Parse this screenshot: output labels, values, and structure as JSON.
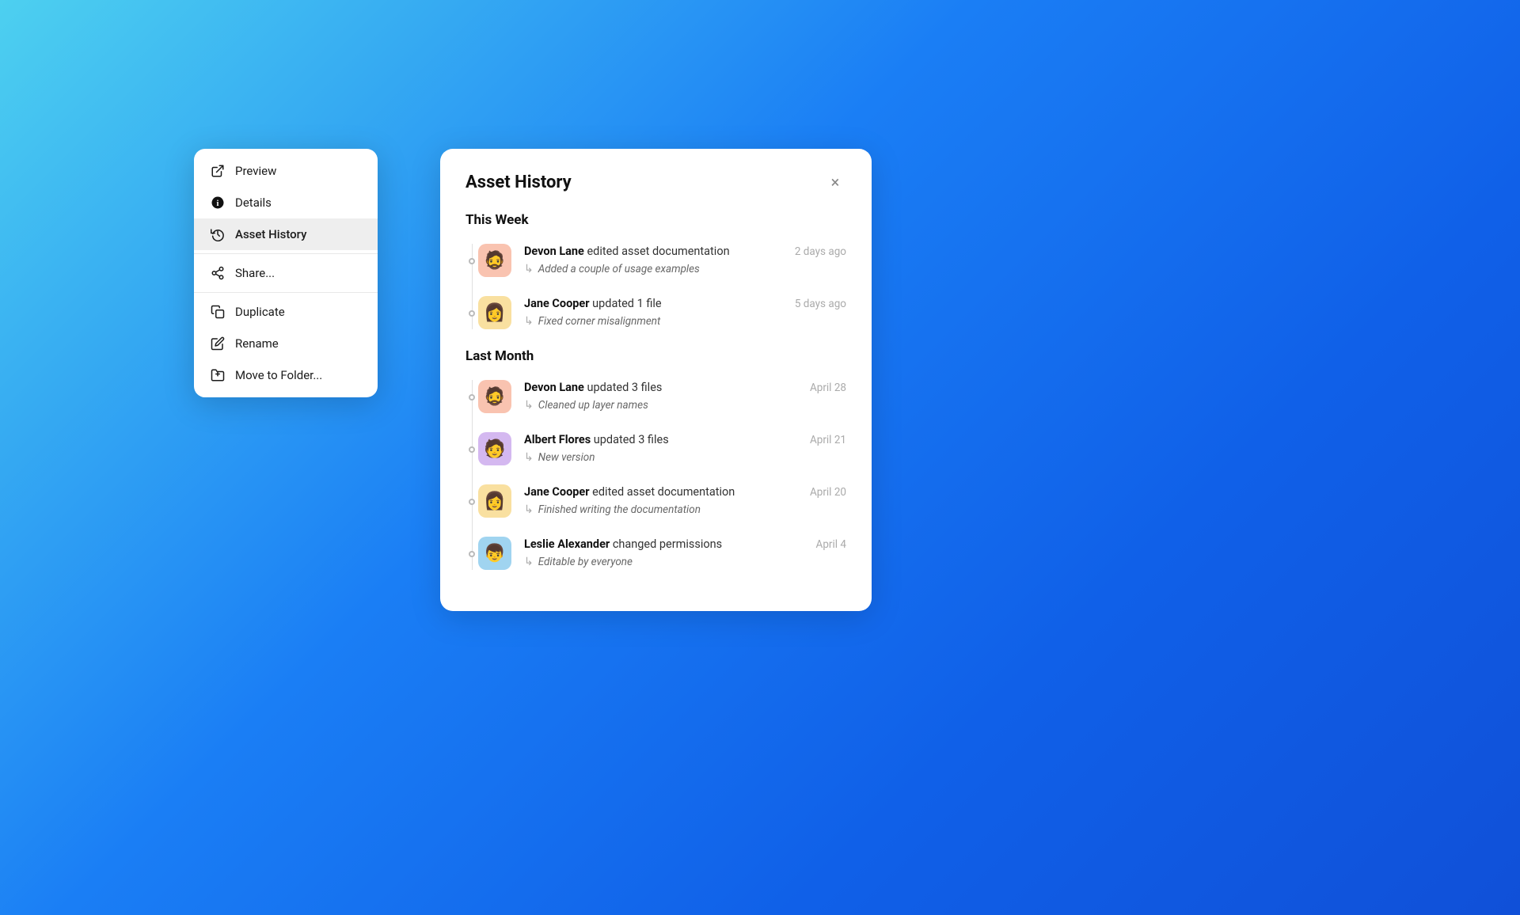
{
  "background": {
    "colors": [
      "#4dd0f0",
      "#1a7ef5",
      "#1060e8",
      "#1050d8"
    ]
  },
  "context_menu": {
    "items": [
      {
        "id": "preview",
        "label": "Preview",
        "icon": "external-link-icon",
        "active": false,
        "has_divider_after": false
      },
      {
        "id": "details",
        "label": "Details",
        "icon": "info-icon",
        "active": false,
        "has_divider_after": false
      },
      {
        "id": "asset-history",
        "label": "Asset History",
        "icon": "history-icon",
        "active": true,
        "has_divider_after": true
      },
      {
        "id": "share",
        "label": "Share...",
        "icon": "share-icon",
        "active": false,
        "has_divider_after": true
      },
      {
        "id": "duplicate",
        "label": "Duplicate",
        "icon": "duplicate-icon",
        "active": false,
        "has_divider_after": false
      },
      {
        "id": "rename",
        "label": "Rename",
        "icon": "pencil-icon",
        "active": false,
        "has_divider_after": false
      },
      {
        "id": "move-to-folder",
        "label": "Move to Folder...",
        "icon": "folder-icon",
        "active": false,
        "has_divider_after": false
      }
    ]
  },
  "history_panel": {
    "title": "Asset History",
    "close_label": "×",
    "sections": [
      {
        "id": "this-week",
        "label": "This Week",
        "items": [
          {
            "id": "devon-1",
            "user": "Devon Lane",
            "action": "edited asset documentation",
            "note": "Added a couple of usage examples",
            "time": "2 days ago",
            "avatar_emoji": "🧔",
            "avatar_class": "avatar-devon"
          },
          {
            "id": "jane-1",
            "user": "Jane Cooper",
            "action": "updated 1 file",
            "note": "Fixed corner misalignment",
            "time": "5 days ago",
            "avatar_emoji": "👩",
            "avatar_class": "avatar-jane"
          }
        ]
      },
      {
        "id": "last-month",
        "label": "Last Month",
        "items": [
          {
            "id": "devon-2",
            "user": "Devon Lane",
            "action": "updated 3 files",
            "note": "Cleaned up layer names",
            "time": "April 28",
            "avatar_emoji": "🧔",
            "avatar_class": "avatar-devon"
          },
          {
            "id": "albert-1",
            "user": "Albert Flores",
            "action": "updated 3 files",
            "note": "New version",
            "time": "April 21",
            "avatar_emoji": "🧑",
            "avatar_class": "avatar-albert"
          },
          {
            "id": "jane-2",
            "user": "Jane Cooper",
            "action": "edited asset documentation",
            "note": "Finished writing the documentation",
            "time": "April 20",
            "avatar_emoji": "👩",
            "avatar_class": "avatar-jane"
          },
          {
            "id": "leslie-1",
            "user": "Leslie Alexander",
            "action": "changed permissions",
            "note": "Editable by everyone",
            "time": "April 4",
            "avatar_emoji": "👦",
            "avatar_class": "avatar-leslie"
          }
        ]
      }
    ]
  }
}
